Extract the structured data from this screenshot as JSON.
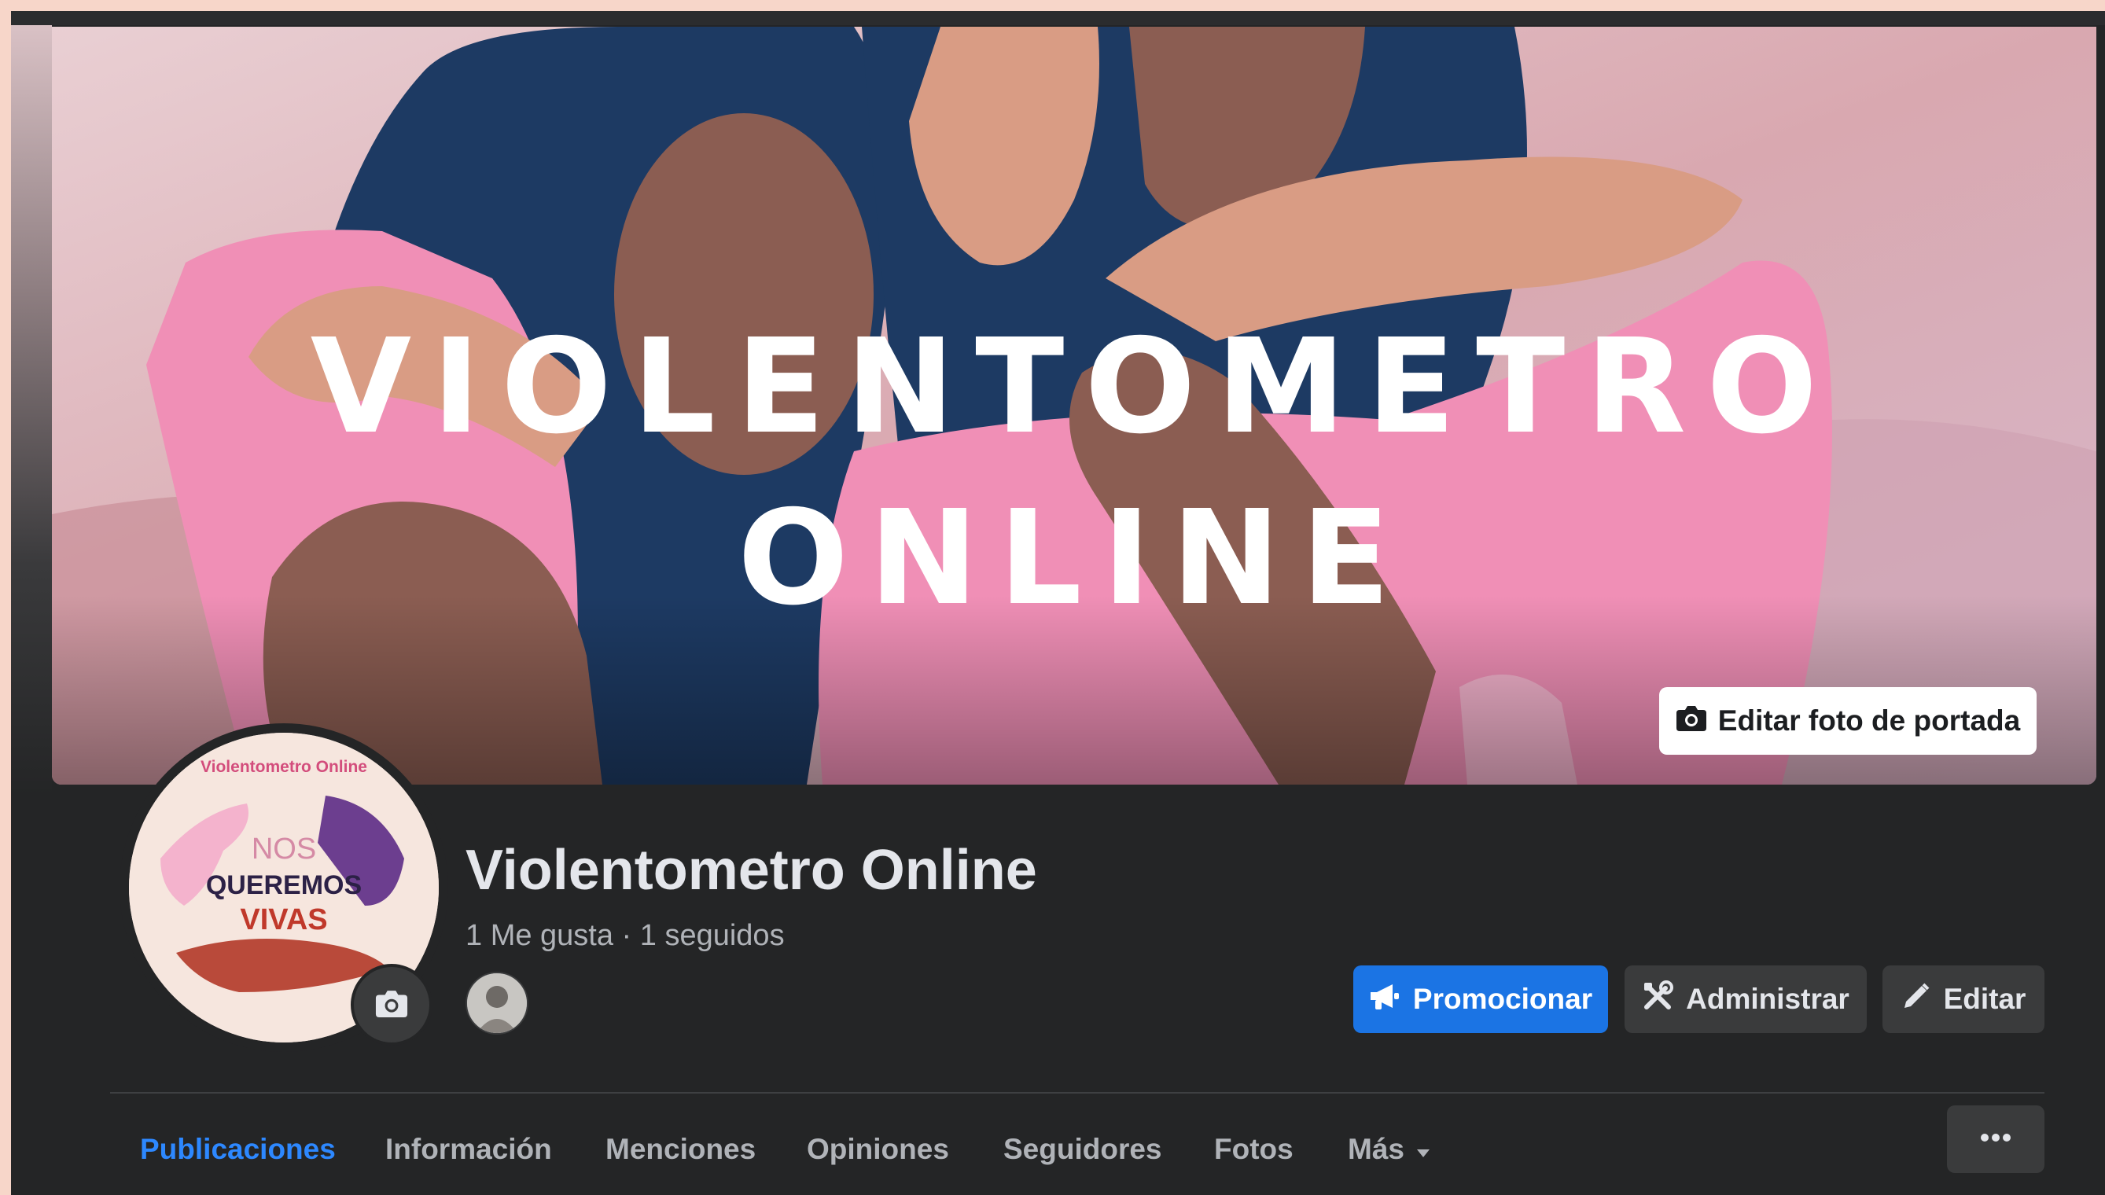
{
  "cover": {
    "title": "VIOLENTOMETRO\nONLINE",
    "edit_cover_label": "Editar foto de portada",
    "edit_cover_icon": "camera-icon"
  },
  "profile": {
    "avatar_text": {
      "top": "Violentometro Online",
      "line1": "NOS",
      "line2": "QUEREMOS",
      "line3": "VIVAS"
    },
    "avatar_badge_icon": "camera-icon",
    "name": "Violentometro Online",
    "stats": "1 Me gusta · 1 seguidos"
  },
  "actions": {
    "promote_label": "Promocionar",
    "promote_icon": "megaphone-icon",
    "manage_label": "Administrar",
    "manage_icon": "tools-icon",
    "edit_label": "Editar",
    "edit_icon": "pencil-icon"
  },
  "tabs": [
    {
      "label": "Publicaciones",
      "active": true
    },
    {
      "label": "Información",
      "active": false
    },
    {
      "label": "Menciones",
      "active": false
    },
    {
      "label": "Opiniones",
      "active": false
    },
    {
      "label": "Seguidores",
      "active": false
    },
    {
      "label": "Fotos",
      "active": false
    },
    {
      "label": "Más",
      "active": false
    }
  ],
  "more_menu_icon": "ellipsis-icon",
  "colors": {
    "background": "#242526",
    "primary": "#1b74e4",
    "active_tab": "#2d88ff",
    "secondary_button": "#3a3b3c",
    "cover_pink": "#f08fb6",
    "cover_navy": "#1d3a63"
  }
}
